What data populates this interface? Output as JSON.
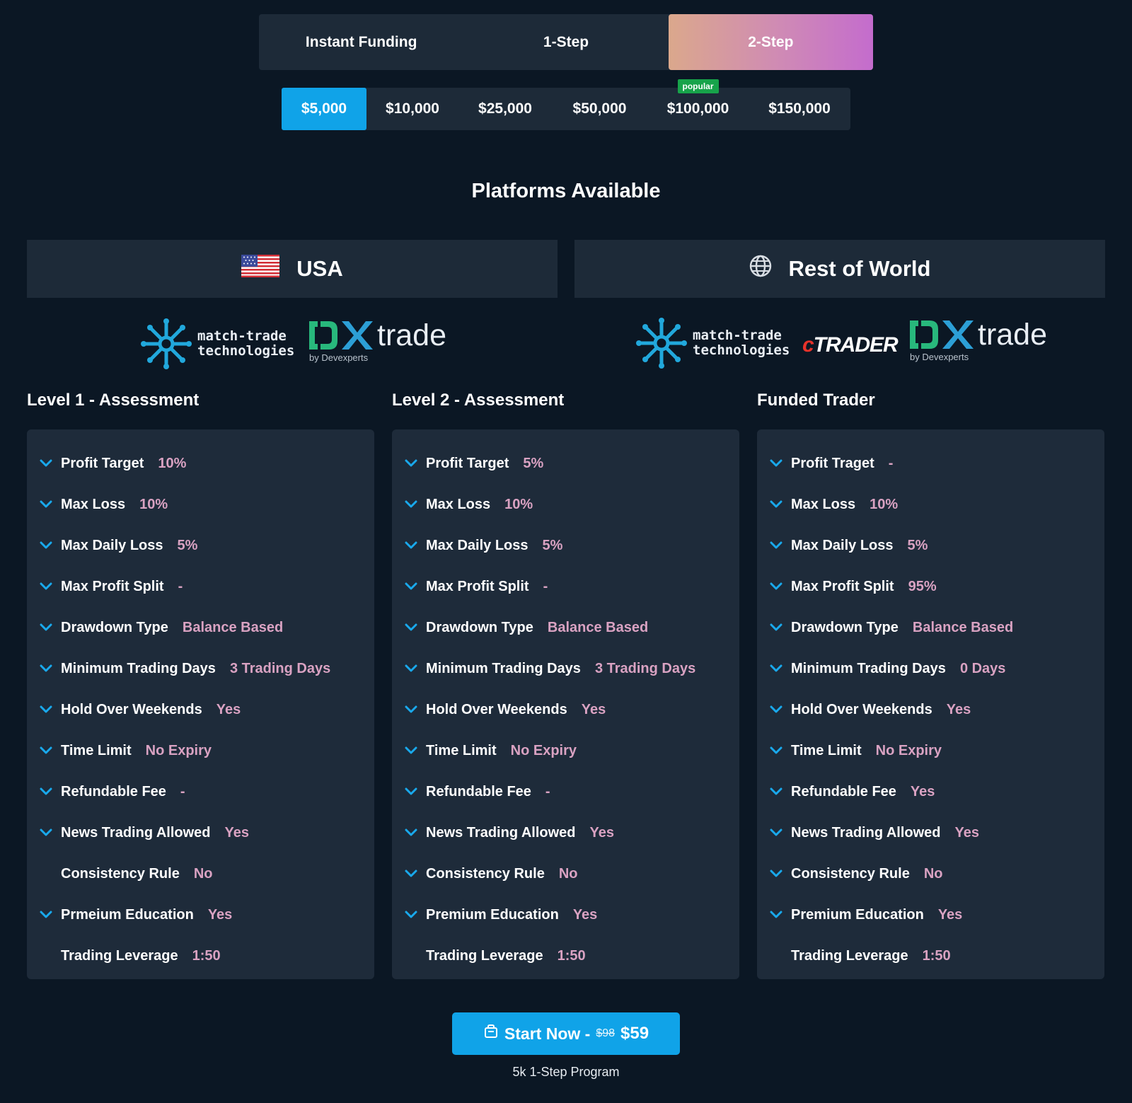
{
  "program_tabs": [
    {
      "label": "Instant Funding",
      "active": false
    },
    {
      "label": "1-Step",
      "active": false
    },
    {
      "label": "2-Step",
      "active": true
    }
  ],
  "account_sizes": [
    {
      "label": "$5,000",
      "active": true
    },
    {
      "label": "$10,000",
      "active": false
    },
    {
      "label": "$25,000",
      "active": false
    },
    {
      "label": "$50,000",
      "active": false
    },
    {
      "label": "$100,000",
      "active": false,
      "badge": "popular"
    },
    {
      "label": "$150,000",
      "active": false
    }
  ],
  "platforms_title": "Platforms Available",
  "regions": {
    "usa": {
      "label": "USA",
      "icon": "us-flag-icon"
    },
    "row": {
      "label": "Rest of World",
      "icon": "globe-icon"
    }
  },
  "logos": {
    "match_trade_line1": "match-trade",
    "match_trade_line2": "technologies",
    "dx_word": "trade",
    "dx_by": "by Devexperts",
    "ctrader_c": "c",
    "ctrader_rest": "TRADER"
  },
  "columns": [
    {
      "title": "Level 1 - Assessment",
      "rows": [
        {
          "label": "Profit Target",
          "value": "10%",
          "chevron": true
        },
        {
          "label": "Max Loss",
          "value": "10%",
          "chevron": true
        },
        {
          "label": "Max Daily Loss",
          "value": "5%",
          "chevron": true
        },
        {
          "label": "Max Profit Split",
          "value": "-",
          "chevron": true
        },
        {
          "label": "Drawdown Type",
          "value": "Balance Based",
          "chevron": true
        },
        {
          "label": "Minimum Trading Days",
          "value": "3 Trading Days",
          "chevron": true
        },
        {
          "label": "Hold Over Weekends",
          "value": "Yes",
          "chevron": true
        },
        {
          "label": "Time Limit",
          "value": "No Expiry",
          "chevron": true
        },
        {
          "label": "Refundable Fee",
          "value": "-",
          "chevron": true
        },
        {
          "label": "News Trading Allowed",
          "value": "Yes",
          "chevron": true
        },
        {
          "label": "Consistency Rule",
          "value": "No",
          "chevron": false
        },
        {
          "label": "Prmeium Education",
          "value": "Yes",
          "chevron": true
        },
        {
          "label": "Trading Leverage",
          "value": "1:50",
          "chevron": false
        }
      ]
    },
    {
      "title": "Level 2 - Assessment",
      "rows": [
        {
          "label": "Profit Target",
          "value": "5%",
          "chevron": true
        },
        {
          "label": "Max Loss",
          "value": "10%",
          "chevron": true
        },
        {
          "label": "Max Daily Loss",
          "value": "5%",
          "chevron": true
        },
        {
          "label": "Max Profit Split",
          "value": "-",
          "chevron": true
        },
        {
          "label": "Drawdown Type",
          "value": "Balance Based",
          "chevron": true
        },
        {
          "label": "Minimum Trading Days",
          "value": "3 Trading Days",
          "chevron": true
        },
        {
          "label": "Hold Over Weekends",
          "value": "Yes",
          "chevron": true
        },
        {
          "label": "Time Limit",
          "value": "No Expiry",
          "chevron": true
        },
        {
          "label": "Refundable Fee",
          "value": "-",
          "chevron": true
        },
        {
          "label": "News Trading Allowed",
          "value": "Yes",
          "chevron": true
        },
        {
          "label": "Consistency Rule",
          "value": "No",
          "chevron": true
        },
        {
          "label": "Premium Education",
          "value": "Yes",
          "chevron": true
        },
        {
          "label": "Trading Leverage",
          "value": "1:50",
          "chevron": false
        }
      ]
    },
    {
      "title": "Funded Trader",
      "rows": [
        {
          "label": "Profit Traget",
          "value": "-",
          "chevron": true
        },
        {
          "label": "Max Loss",
          "value": "10%",
          "chevron": true
        },
        {
          "label": "Max Daily Loss",
          "value": "5%",
          "chevron": true
        },
        {
          "label": "Max Profit Split",
          "value": "95%",
          "chevron": true
        },
        {
          "label": "Drawdown Type",
          "value": "Balance Based",
          "chevron": true
        },
        {
          "label": "Minimum Trading Days",
          "value": "0 Days",
          "chevron": true
        },
        {
          "label": "Hold Over Weekends",
          "value": "Yes",
          "chevron": true
        },
        {
          "label": "Time Limit",
          "value": "No Expiry",
          "chevron": true
        },
        {
          "label": "Refundable Fee",
          "value": "Yes",
          "chevron": true
        },
        {
          "label": "News Trading Allowed",
          "value": "Yes",
          "chevron": true
        },
        {
          "label": "Consistency Rule",
          "value": "No",
          "chevron": true
        },
        {
          "label": "Premium Education",
          "value": "Yes",
          "chevron": true
        },
        {
          "label": "Trading Leverage",
          "value": "1:50",
          "chevron": false
        }
      ]
    }
  ],
  "cta": {
    "icon": "cart-icon",
    "label": "Start Now -",
    "old_price": "$98",
    "new_price": "$59",
    "subtext": "5k 1-Step Program"
  },
  "colors": {
    "background": "#0b1724",
    "panel": "#1d2a38",
    "accent_blue": "#10a3e8",
    "value_pink": "#d9a2c2",
    "badge_green": "#17a34a"
  }
}
